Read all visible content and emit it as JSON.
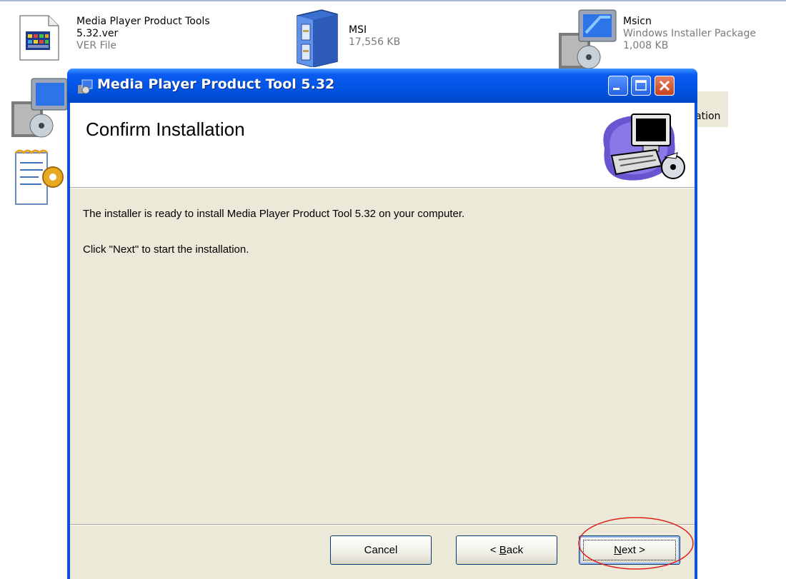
{
  "desktop": {
    "files": [
      {
        "name_line1": "Media Player Product Tools",
        "name_line2": "5.32.ver",
        "type": "VER File",
        "icon": "ver-file-icon"
      },
      {
        "name_line1": "MSI",
        "name_line2": "",
        "size": "17,556 KB",
        "icon": "filing-cabinet-icon"
      },
      {
        "name_line1": "Msicn",
        "type": "Windows Installer Package",
        "size": "1,008 KB",
        "icon": "installer-package-icon"
      }
    ],
    "partial_label": "ation"
  },
  "dialog": {
    "title": "Media Player Product Tool 5.32",
    "banner_title": "Confirm Installation",
    "message1": "The installer is ready to install Media Player Product Tool 5.32 on your computer.",
    "message2": "Click \"Next\" to start the installation.",
    "buttons": {
      "cancel": "Cancel",
      "back_prefix": "< ",
      "back_mnemonic": "B",
      "back_rest": "ack",
      "next_mnemonic": "N",
      "next_rest": "ext >"
    }
  },
  "colors": {
    "titlebar": "#0054e3",
    "dialog_face": "#ece9d8",
    "annotation": "#e0201c"
  }
}
